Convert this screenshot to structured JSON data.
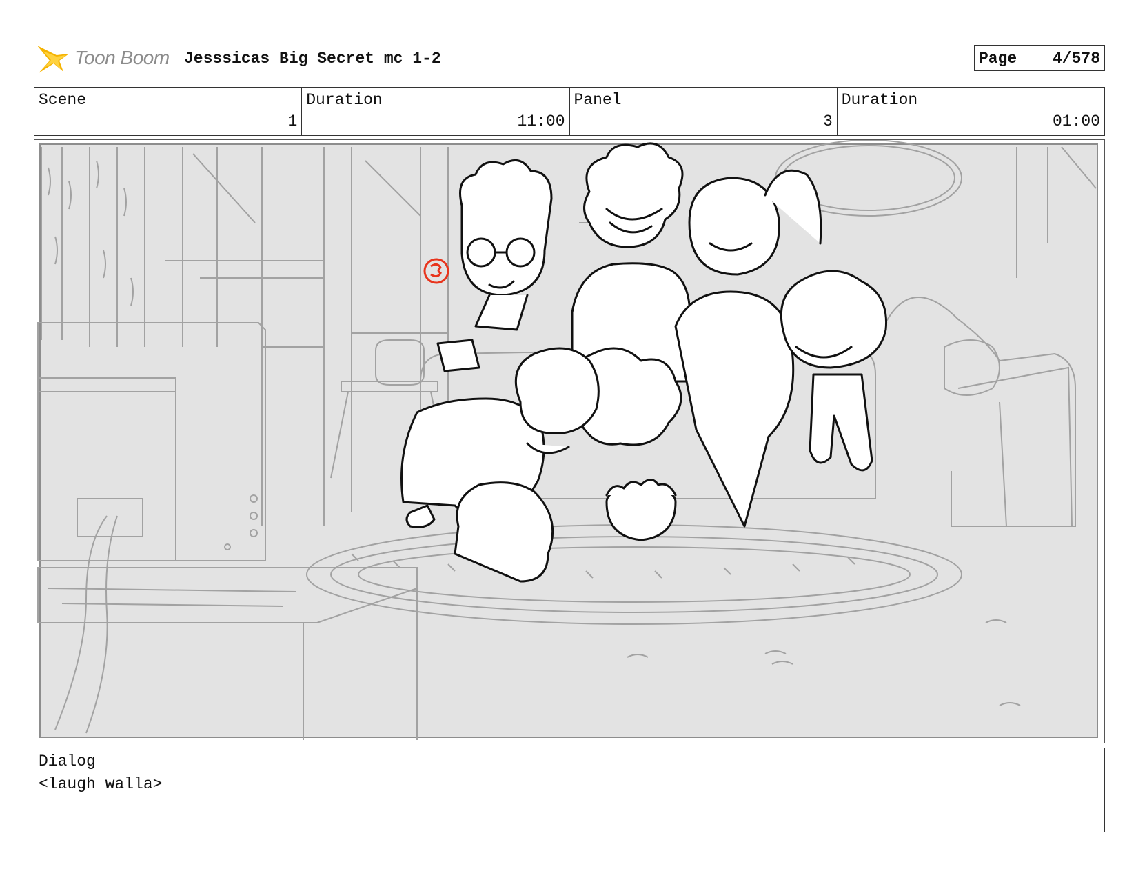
{
  "header": {
    "logo_text": "Toon Boom",
    "logo_icon": "toon-boom-star-icon",
    "title": "Jesssicas Big Secret mc 1-2",
    "page_label": "Page",
    "page_value": "4/578"
  },
  "info": {
    "scene_label": "Scene",
    "scene_value": "1",
    "scene_duration_label": "Duration",
    "scene_duration_value": "11:00",
    "panel_label": "Panel",
    "panel_value": "3",
    "panel_duration_label": "Duration",
    "panel_duration_value": "01:00"
  },
  "panel_image": {
    "colors": {
      "background_sketch": "#9a9a9a",
      "character_lines": "#111111",
      "accent_mark": "#e8341c"
    }
  },
  "dialog": {
    "label": "Dialog",
    "text": "<laugh walla>"
  }
}
